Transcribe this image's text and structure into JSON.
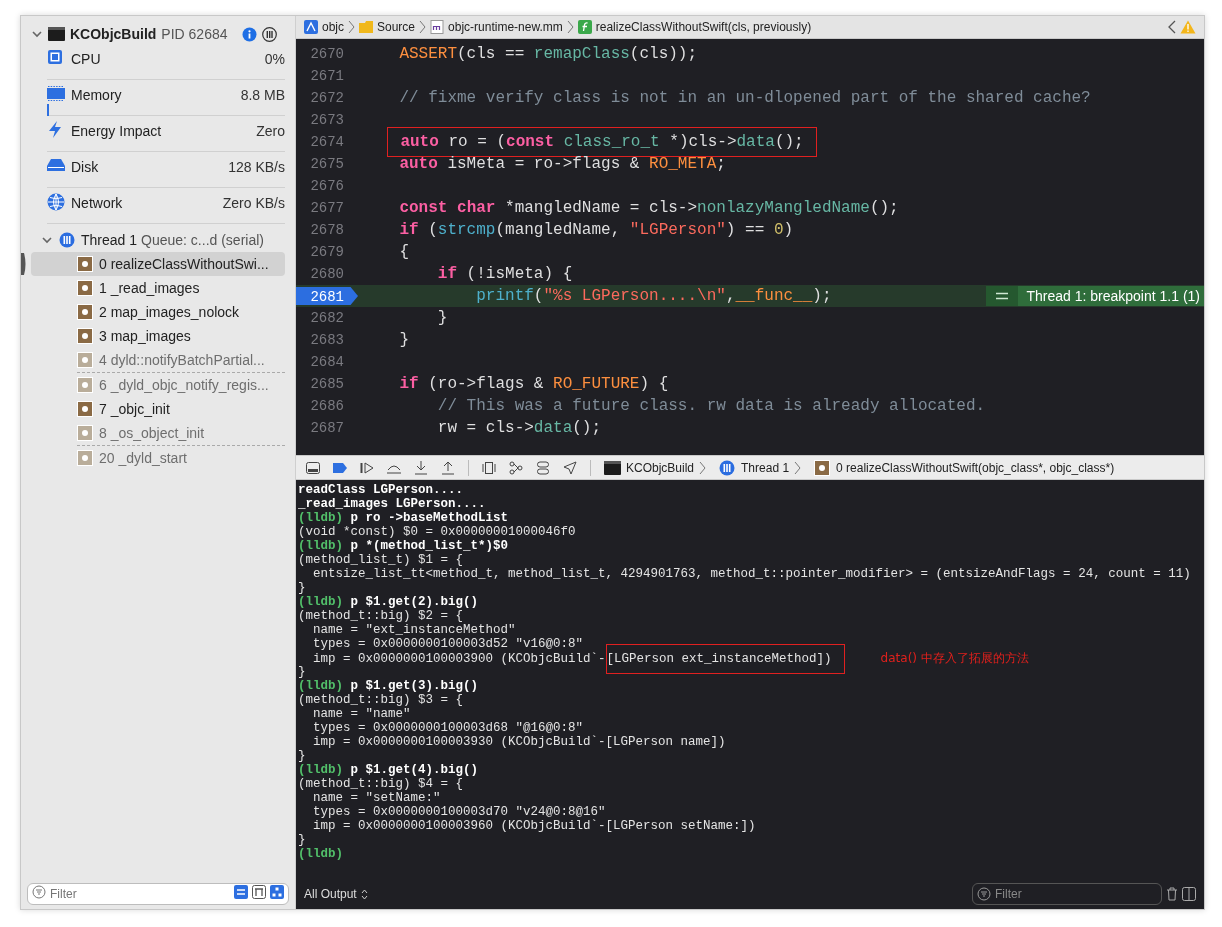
{
  "process": {
    "name": "KCObjcBuild",
    "pid": "PID 62684",
    "expanded": true
  },
  "gauges": [
    {
      "kind": "cpu",
      "label": "CPU",
      "value": "0%"
    },
    {
      "kind": "memory",
      "label": "Memory",
      "value": "8.8 MB"
    },
    {
      "kind": "energy",
      "label": "Energy Impact",
      "value": "Zero"
    },
    {
      "kind": "disk",
      "label": "Disk",
      "value": "128 KB/s"
    },
    {
      "kind": "network",
      "label": "Network",
      "value": "Zero KB/s"
    }
  ],
  "thread": {
    "label": "Thread 1",
    "queue": "Queue: c...d (serial)",
    "expanded": true
  },
  "frames": [
    {
      "label": "0 realizeClassWithoutSwi...",
      "selected": true,
      "dimmed": false,
      "gap_after": false
    },
    {
      "label": "1 _read_images",
      "selected": false,
      "dimmed": false,
      "gap_after": false
    },
    {
      "label": "2 map_images_nolock",
      "selected": false,
      "dimmed": false,
      "gap_after": false
    },
    {
      "label": "3 map_images",
      "selected": false,
      "dimmed": false,
      "gap_after": false
    },
    {
      "label": "4 dyld::notifyBatchPartial...",
      "selected": false,
      "dimmed": true,
      "gap_after": true
    },
    {
      "label": "6 _dyld_objc_notify_regis...",
      "selected": false,
      "dimmed": true,
      "gap_after": false
    },
    {
      "label": "7 _objc_init",
      "selected": false,
      "dimmed": false,
      "gap_after": false
    },
    {
      "label": "8 _os_object_init",
      "selected": false,
      "dimmed": true,
      "gap_after": true
    },
    {
      "label": "20 _dyld_start",
      "selected": false,
      "dimmed": true,
      "gap_after": false
    }
  ],
  "sidebar_filter": {
    "placeholder": "Filter"
  },
  "breadcrumbs": [
    {
      "kind": "project",
      "label": "objc"
    },
    {
      "kind": "folder",
      "label": "Source"
    },
    {
      "kind": "file",
      "label": "objc-runtime-new.mm"
    },
    {
      "kind": "function",
      "label": "realizeClassWithoutSwift(cls, previously)"
    }
  ],
  "code_lines": [
    {
      "number": "2670",
      "tokens": [
        {
          "text": "    ASSERT",
          "kind": "macro"
        },
        {
          "text": "(cls == ",
          "kind": "plain"
        },
        {
          "text": "remapClass",
          "kind": "func"
        },
        {
          "text": "(cls));",
          "kind": "plain"
        }
      ]
    },
    {
      "number": "2671"
    },
    {
      "number": "2672",
      "tokens": [
        {
          "text": "    // fixme verify class is not in an un-dlopened part of the shared cache?",
          "kind": "comment"
        }
      ]
    },
    {
      "number": "2673"
    },
    {
      "number": "2674",
      "boxed": true,
      "tokens": [
        {
          "text": "    auto",
          "kind": "keyword"
        },
        {
          "text": " ro = (",
          "kind": "plain"
        },
        {
          "text": "const",
          "kind": "keyword"
        },
        {
          "text": " class_ro_t",
          "kind": "type"
        },
        {
          "text": " *)cls->",
          "kind": "plain"
        },
        {
          "text": "data",
          "kind": "func"
        },
        {
          "text": "();",
          "kind": "plain"
        }
      ]
    },
    {
      "number": "2675",
      "tokens": [
        {
          "text": "    auto",
          "kind": "keyword"
        },
        {
          "text": " isMeta = ro->flags & ",
          "kind": "plain"
        },
        {
          "text": "RO_META",
          "kind": "macro"
        },
        {
          "text": ";",
          "kind": "plain"
        }
      ]
    },
    {
      "number": "2676"
    },
    {
      "number": "2677",
      "tokens": [
        {
          "text": "    const",
          "kind": "keyword"
        },
        {
          "text": " char",
          "kind": "keyword"
        },
        {
          "text": " *mangledName = cls->",
          "kind": "plain"
        },
        {
          "text": "nonlazyMangledName",
          "kind": "func"
        },
        {
          "text": "();",
          "kind": "plain"
        }
      ]
    },
    {
      "number": "2678",
      "tokens": [
        {
          "text": "    if",
          "kind": "keyword"
        },
        {
          "text": " (",
          "kind": "plain"
        },
        {
          "text": "strcmp",
          "kind": "sysfunc"
        },
        {
          "text": "(mangledName, ",
          "kind": "plain"
        },
        {
          "text": "\"LGPerson\"",
          "kind": "string"
        },
        {
          "text": ") == ",
          "kind": "plain"
        },
        {
          "text": "0",
          "kind": "number"
        },
        {
          "text": ")",
          "kind": "plain"
        }
      ]
    },
    {
      "number": "2679",
      "tokens": [
        {
          "text": "    {",
          "kind": "plain"
        }
      ]
    },
    {
      "number": "2680",
      "tokens": [
        {
          "text": "        if",
          "kind": "keyword"
        },
        {
          "text": " (!isMeta) {",
          "kind": "plain"
        }
      ]
    },
    {
      "number": "2681",
      "current": true,
      "breakpoint": "Thread 1: breakpoint 1.1 (1)",
      "tokens": [
        {
          "text": "            printf",
          "kind": "sysfunc"
        },
        {
          "text": "(",
          "kind": "plain"
        },
        {
          "text": "\"%s LGPerson....\\n\"",
          "kind": "string"
        },
        {
          "text": ",",
          "kind": "plain"
        },
        {
          "text": "__func__",
          "kind": "macro"
        },
        {
          "text": ");",
          "kind": "plain"
        }
      ]
    },
    {
      "number": "2682",
      "tokens": [
        {
          "text": "        }",
          "kind": "plain"
        }
      ]
    },
    {
      "number": "2683",
      "tokens": [
        {
          "text": "    }",
          "kind": "plain"
        }
      ]
    },
    {
      "number": "2684"
    },
    {
      "number": "2685",
      "tokens": [
        {
          "text": "    if",
          "kind": "keyword"
        },
        {
          "text": " (ro->flags & ",
          "kind": "plain"
        },
        {
          "text": "RO_FUTURE",
          "kind": "macro"
        },
        {
          "text": ") {",
          "kind": "plain"
        }
      ]
    },
    {
      "number": "2686",
      "tokens": [
        {
          "text": "        // This was a future class. rw data is already allocated.",
          "kind": "comment"
        }
      ]
    },
    {
      "number": "2687",
      "tokens": [
        {
          "text": "        rw = cls->",
          "kind": "plain"
        },
        {
          "text": "data",
          "kind": "func"
        },
        {
          "text": "();",
          "kind": "plain"
        }
      ]
    }
  ],
  "debug_path": [
    {
      "kind": "process",
      "label": "KCObjcBuild"
    },
    {
      "kind": "thread",
      "label": "Thread 1"
    },
    {
      "kind": "frame",
      "label": "0 realizeClassWithoutSwift(objc_class*, objc_class*)"
    }
  ],
  "console": [
    {
      "kind": "output",
      "text": "readClass LGPerson...."
    },
    {
      "kind": "output",
      "text": "_read_images LGPerson...."
    },
    {
      "kind": "command",
      "prompt": "(lldb)",
      "text": "p ro ->baseMethodList"
    },
    {
      "kind": "output",
      "text": "(void *const) $0 = 0x00000001000046f0"
    },
    {
      "kind": "command",
      "prompt": "(lldb)",
      "text": "p *(method_list_t*)$0"
    },
    {
      "kind": "output",
      "text": "(method_list_t) $1 = {"
    },
    {
      "kind": "output",
      "text": "  entsize_list_tt<method_t, method_list_t, 4294901763, method_t::pointer_modifier> = (entsizeAndFlags = 24, count = 11)"
    },
    {
      "kind": "output",
      "text": "}"
    },
    {
      "kind": "command",
      "prompt": "(lldb)",
      "text": "p $1.get(2).big()"
    },
    {
      "kind": "output",
      "text": "(method_t::big) $2 = {"
    },
    {
      "kind": "output",
      "text": "  name = \"ext_instanceMethod\""
    },
    {
      "kind": "output",
      "text": "  types = 0x0000000100003d52 \"v16@0:8\""
    },
    {
      "kind": "output",
      "text": "  imp = 0x0000000100003900 (KCObjcBuild`-",
      "boxed": "[LGPerson ext_instanceMethod])",
      "note": "data() 中存入了拓展的方法"
    },
    {
      "kind": "output",
      "text": "}"
    },
    {
      "kind": "command",
      "prompt": "(lldb)",
      "text": "p $1.get(3).big()"
    },
    {
      "kind": "output",
      "text": "(method_t::big) $3 = {"
    },
    {
      "kind": "output",
      "text": "  name = \"name\""
    },
    {
      "kind": "output",
      "text": "  types = 0x0000000100003d68 \"@16@0:8\""
    },
    {
      "kind": "output",
      "text": "  imp = 0x0000000100003930 (KCObjcBuild`-[LGPerson name])"
    },
    {
      "kind": "output",
      "text": "}"
    },
    {
      "kind": "command",
      "prompt": "(lldb)",
      "text": "p $1.get(4).big()"
    },
    {
      "kind": "output",
      "text": "(method_t::big) $4 = {"
    },
    {
      "kind": "output",
      "text": "  name = \"setName:\""
    },
    {
      "kind": "output",
      "text": "  types = 0x0000000100003d70 \"v24@0:8@16\""
    },
    {
      "kind": "output",
      "text": "  imp = 0x0000000100003960 (KCObjcBuild`-[LGPerson setName:])"
    },
    {
      "kind": "output",
      "text": "}"
    },
    {
      "kind": "prompt",
      "prompt": "(lldb)"
    }
  ],
  "console_footer": {
    "output_menu": "All Output",
    "filter_placeholder": "Filter"
  }
}
